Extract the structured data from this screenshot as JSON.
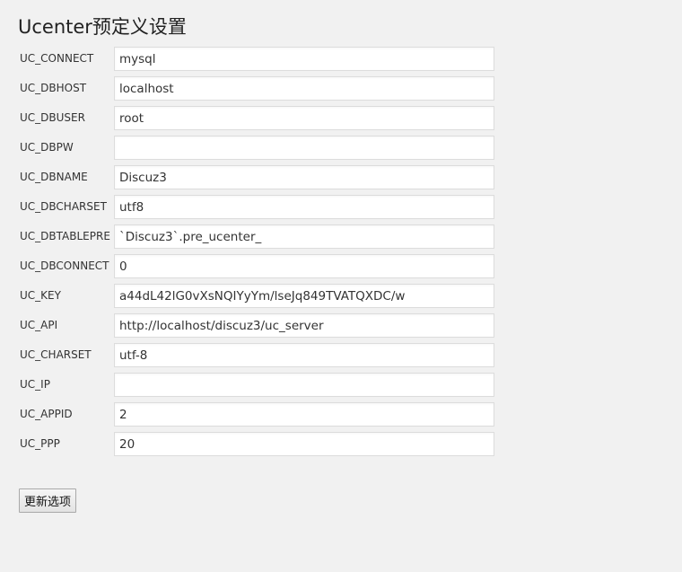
{
  "page": {
    "title": "Ucenter预定义设置"
  },
  "settings": [
    {
      "label": "UC_CONNECT",
      "value": "mysql"
    },
    {
      "label": "UC_DBHOST",
      "value": "localhost"
    },
    {
      "label": "UC_DBUSER",
      "value": "root"
    },
    {
      "label": "UC_DBPW",
      "value": ""
    },
    {
      "label": "UC_DBNAME",
      "value": "Discuz3"
    },
    {
      "label": "UC_DBCHARSET",
      "value": "utf8"
    },
    {
      "label": "UC_DBTABLEPRE",
      "value": "`Discuz3`.pre_ucenter_"
    },
    {
      "label": "UC_DBCONNECT",
      "value": "0"
    },
    {
      "label": "UC_KEY",
      "value": "a44dL42lG0vXsNQIYyYm/lseJq849TVATQXDC/w"
    },
    {
      "label": "UC_API",
      "value": "http://localhost/discuz3/uc_server"
    },
    {
      "label": "UC_CHARSET",
      "value": "utf-8"
    },
    {
      "label": "UC_IP",
      "value": ""
    },
    {
      "label": "UC_APPID",
      "value": "2"
    },
    {
      "label": "UC_PPP",
      "value": "20"
    }
  ],
  "actions": {
    "submit_label": "更新选项"
  }
}
